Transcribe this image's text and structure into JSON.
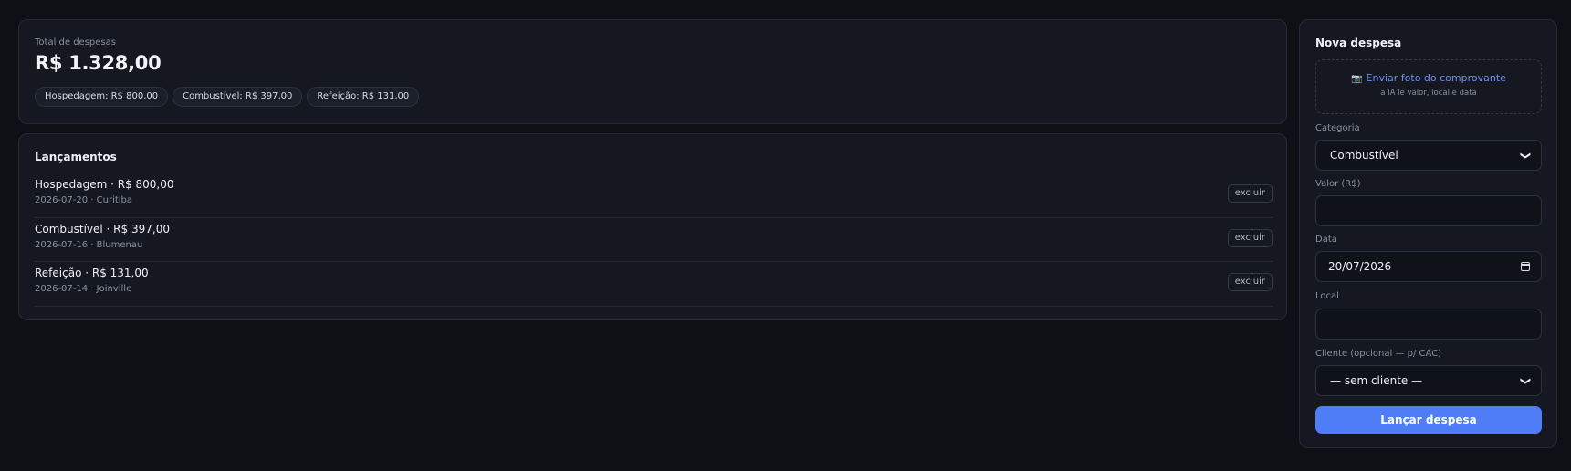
{
  "summary": {
    "label": "Total de despesas",
    "total": "R$ 1.328,00",
    "chips": [
      "Hospedagem: R$ 800,00",
      "Combustível: R$ 397,00",
      "Refeição: R$ 131,00"
    ]
  },
  "entries": {
    "title": "Lançamentos",
    "delete_label": "excluir",
    "rows": [
      {
        "main": "Hospedagem · R$ 800,00",
        "sub": "2026-07-20 · Curitiba"
      },
      {
        "main": "Combustível · R$ 397,00",
        "sub": "2026-07-16 · Blumenau"
      },
      {
        "main": "Refeição · R$ 131,00",
        "sub": "2026-07-14 · Joinville"
      }
    ]
  },
  "form": {
    "title": "Nova despesa",
    "upload": {
      "icon": "camera-icon",
      "link": "Enviar foto do comprovante",
      "hint": "a IA lê valor, local e data"
    },
    "category": {
      "label": "Categoria",
      "value": "Combustível"
    },
    "amount": {
      "label": "Valor (R$)",
      "value": ""
    },
    "date": {
      "label": "Data",
      "value": "20/07/2026"
    },
    "place": {
      "label": "Local",
      "value": ""
    },
    "client": {
      "label": "Cliente (opcional — p/ CAC)",
      "value": "— sem cliente —"
    },
    "submit": "Lançar despesa"
  },
  "colors": {
    "background": "#0e1016",
    "card": "#151821",
    "accent": "#4f7cf7",
    "link": "#6f8cff"
  }
}
